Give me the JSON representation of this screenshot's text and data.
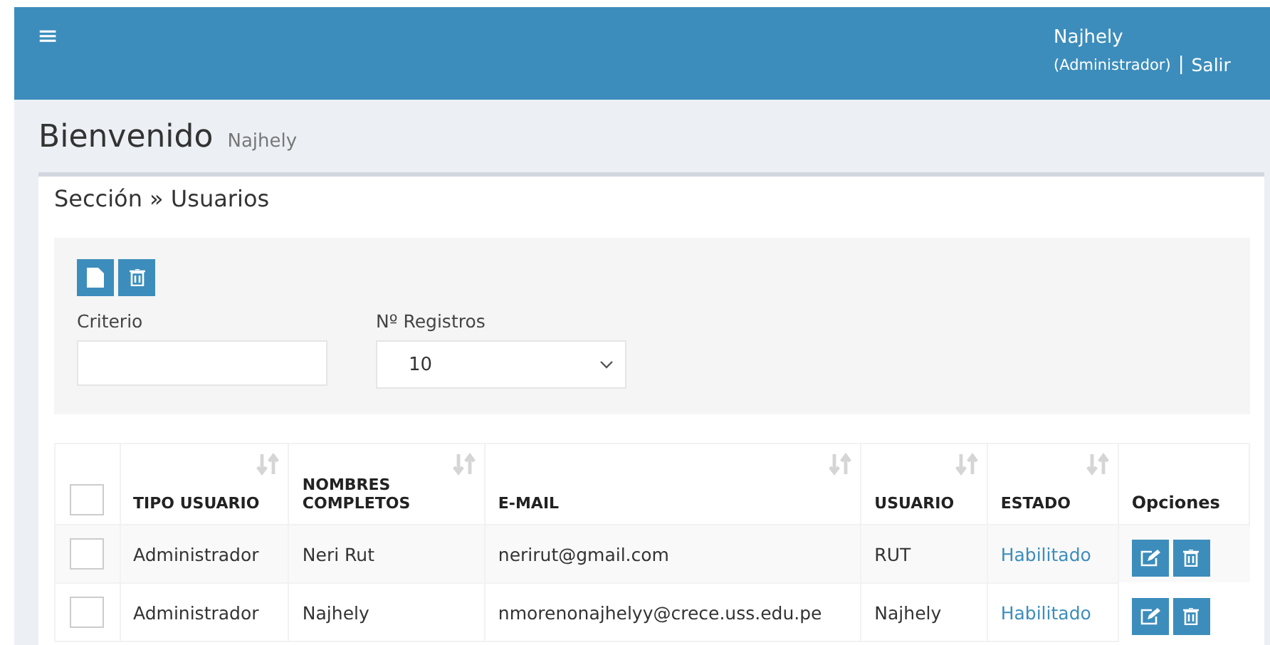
{
  "header": {
    "menu_icon": "≡",
    "user_name": "Najhely",
    "role": "(Administrador)",
    "separator": "|",
    "logout": "Salir"
  },
  "page": {
    "title": "Bienvenido",
    "subtitle": "Najhely"
  },
  "section": {
    "title": "Sección » Usuarios"
  },
  "filters": {
    "criterio_label": "Criterio",
    "registros_label": "Nº Registros",
    "registros_value": "10"
  },
  "table": {
    "select_all_checked": false,
    "columns": [
      {
        "label": "TIPO USUARIO",
        "sortable": true
      },
      {
        "label": "NOMBRES COMPLETOS",
        "sortable": true
      },
      {
        "label": "E-MAIL",
        "sortable": true
      },
      {
        "label": "USUARIO",
        "sortable": true
      },
      {
        "label": "ESTADO",
        "sortable": true
      },
      {
        "label": "Opciones",
        "sortable": false
      }
    ],
    "rows": [
      {
        "checked": false,
        "tipo": "Administrador",
        "nombre": "Neri Rut",
        "email": "nerirut@gmail.com",
        "usuario": "RUT",
        "estado": "Habilitado"
      },
      {
        "checked": false,
        "tipo": "Administrador",
        "nombre": "Najhely",
        "email": "nmorenonajhelyy@crece.uss.edu.pe",
        "usuario": "Najhely",
        "estado": "Habilitado"
      }
    ]
  }
}
